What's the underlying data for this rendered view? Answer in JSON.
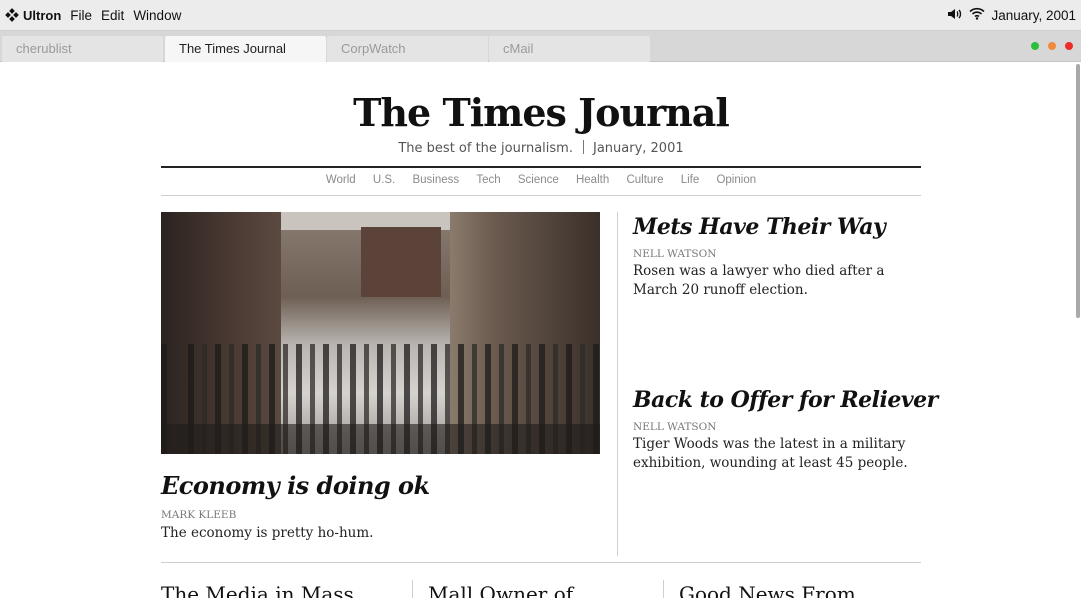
{
  "menubar": {
    "app_name": "Ultron",
    "menus": [
      "File",
      "Edit",
      "Window"
    ],
    "date": "January, 2001",
    "icons": [
      "volume-icon",
      "wifi-icon"
    ]
  },
  "tabs": [
    {
      "label": "cherublist",
      "active": false
    },
    {
      "label": "The Times Journal",
      "active": true
    },
    {
      "label": "CorpWatch",
      "active": false
    },
    {
      "label": "cMail",
      "active": false
    }
  ],
  "window_controls": {
    "colors": [
      "#2bbf3c",
      "#f08a3c",
      "#ee2b2b"
    ]
  },
  "page": {
    "masthead": "The Times Journal",
    "tagline": "The best of the journalism.",
    "date": "January, 2001",
    "nav": [
      "World",
      "U.S.",
      "Business",
      "Tech",
      "Science",
      "Health",
      "Culture",
      "Life",
      "Opinion"
    ],
    "main_story": {
      "headline": "Economy is doing ok",
      "byline": "MARK KLEEB",
      "summary": "The economy is pretty ho-hum."
    },
    "side_stories": [
      {
        "headline": "Mets Have Their Way",
        "byline": "NELL WATSON",
        "summary": "Rosen was a lawyer who died after a March 20 runoff election."
      },
      {
        "headline": "Back to Offer for Reliever",
        "byline": "NELL WATSON",
        "summary": "Tiger Woods was the latest in a military exhibition, wounding at least 45 people."
      }
    ],
    "bottom_headlines": [
      "The Media in Mass",
      "Mall Owner of",
      "Good News From"
    ]
  }
}
